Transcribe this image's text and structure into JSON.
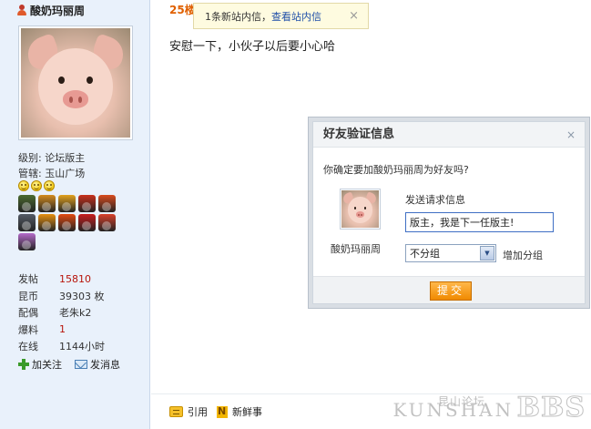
{
  "sidebar": {
    "username": "酸奶玛丽周",
    "level_label": "级别:",
    "level_value": "论坛版主",
    "manage_label": "管辖:",
    "manage_value": "玉山广场",
    "stats": [
      {
        "label": "发帖",
        "value": "15810",
        "color": "#b8140b"
      },
      {
        "label": "昆币",
        "value": "39303 枚",
        "color": "#333333"
      },
      {
        "label": "配偶",
        "value": "老朱k2",
        "color": "#333333"
      },
      {
        "label": "爆料",
        "value": "1",
        "color": "#b8140b"
      },
      {
        "label": "在线",
        "value": "1144小时",
        "color": "#333333"
      }
    ],
    "follow_label": "加关注",
    "message_label": "发消息",
    "medal_colors": [
      "#4b6b2f",
      "#d38b1f",
      "#e1a11e",
      "#c8301c",
      "#d84b1e",
      "#555b66",
      "#e58f10",
      "#e24a10",
      "#c81d1d",
      "#d8402a",
      "#b46ac9"
    ]
  },
  "post": {
    "floor": "25楼",
    "content": "安慰一下，小伙子以后要小心哈"
  },
  "notification": {
    "text": "1条新站内信，",
    "link": "查看站内信",
    "close": "×"
  },
  "dialog": {
    "title": "好友验证信息",
    "close": "×",
    "question": "你确定要加酸奶玛丽周为好友吗?",
    "user": "酸奶玛丽周",
    "send_label": "发送请求信息",
    "message_value": "版主，我是下一任版主!",
    "group_selected": "不分组",
    "add_group": "增加分组",
    "submit": "提交"
  },
  "bottom": {
    "quote_label": "引用",
    "news_label": "新鲜事"
  },
  "watermark": {
    "cn": "昆山论坛",
    "en": "KUNSHAN",
    "bbs": "BBS"
  },
  "colors": {
    "accent_orange": "#e06000",
    "link_blue": "#1f4fa8",
    "sidebar_bg": "#e9f1fb"
  }
}
